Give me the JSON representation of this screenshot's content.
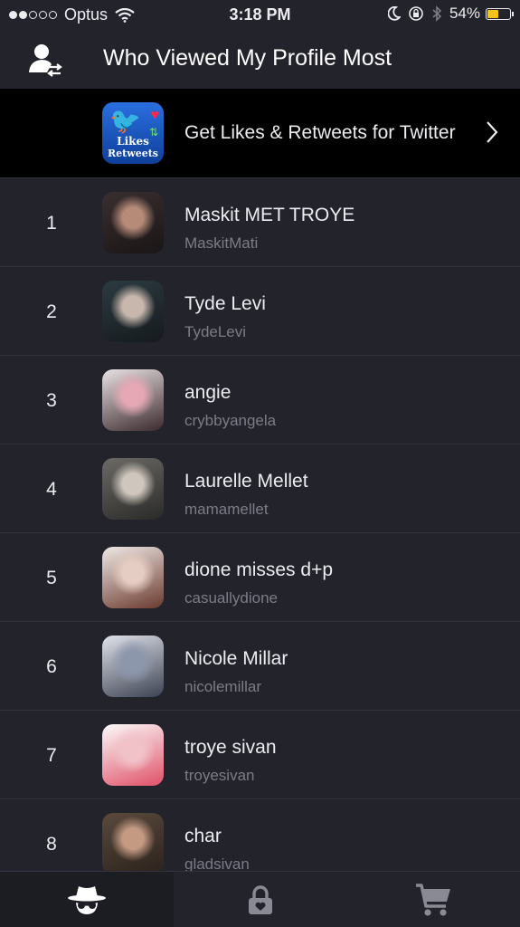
{
  "status_bar": {
    "signal_full": 2,
    "signal_total": 5,
    "carrier": "Optus",
    "time": "3:18 PM",
    "battery": "54%",
    "battery_level": 0.54,
    "battery_color": "#f3c316",
    "icons": [
      "wifi-icon",
      "moon-icon",
      "rotation-lock-icon",
      "bluetooth-icon"
    ]
  },
  "nav": {
    "title": "Who Viewed My Profile Most",
    "icon": "user-swap-icon"
  },
  "promo": {
    "title": "Get Likes & Retweets for Twitter",
    "icon_line1": "Likes",
    "icon_line2": "Retweets"
  },
  "list": [
    {
      "rank": "1",
      "name": "Maskit MET TROYE",
      "handle": "MaskitMati",
      "colors": [
        "#3a2f30",
        "#b68b78",
        "#1a1516"
      ]
    },
    {
      "rank": "2",
      "name": "Tyde Levi",
      "handle": "TydeLevi",
      "colors": [
        "#2c3b42",
        "#c7b7ad",
        "#151a1d"
      ]
    },
    {
      "rank": "3",
      "name": "angie",
      "handle": "crybbyangela",
      "colors": [
        "#e9e2e4",
        "#e7a8b5",
        "#3b2a2d"
      ]
    },
    {
      "rank": "4",
      "name": "Laurelle Mellet",
      "handle": "mamamellet",
      "colors": [
        "#6c6a66",
        "#cfc7bd",
        "#2a2a28"
      ]
    },
    {
      "rank": "5",
      "name": "dione misses d+p",
      "handle": "casuallydione",
      "colors": [
        "#efe9e6",
        "#e6cdc3",
        "#6b3a2e"
      ]
    },
    {
      "rank": "6",
      "name": "Nicole Millar",
      "handle": "nicolemillar",
      "colors": [
        "#dfe2ea",
        "#8d97ac",
        "#3d4252"
      ]
    },
    {
      "rank": "7",
      "name": "troye sivan",
      "handle": "troyesivan",
      "colors": [
        "#fbfbfb",
        "#f1c2c8",
        "#e05067"
      ]
    },
    {
      "rank": "8",
      "name": "char",
      "handle": "gladsivan",
      "colors": [
        "#5a4a3c",
        "#c49a83",
        "#2b221c"
      ]
    }
  ],
  "tabs": [
    {
      "name": "tab-spy",
      "icon": "spy-icon",
      "active": true
    },
    {
      "name": "tab-lock",
      "icon": "lock-icon",
      "active": false
    },
    {
      "name": "tab-cart",
      "icon": "cart-icon",
      "active": false
    }
  ]
}
